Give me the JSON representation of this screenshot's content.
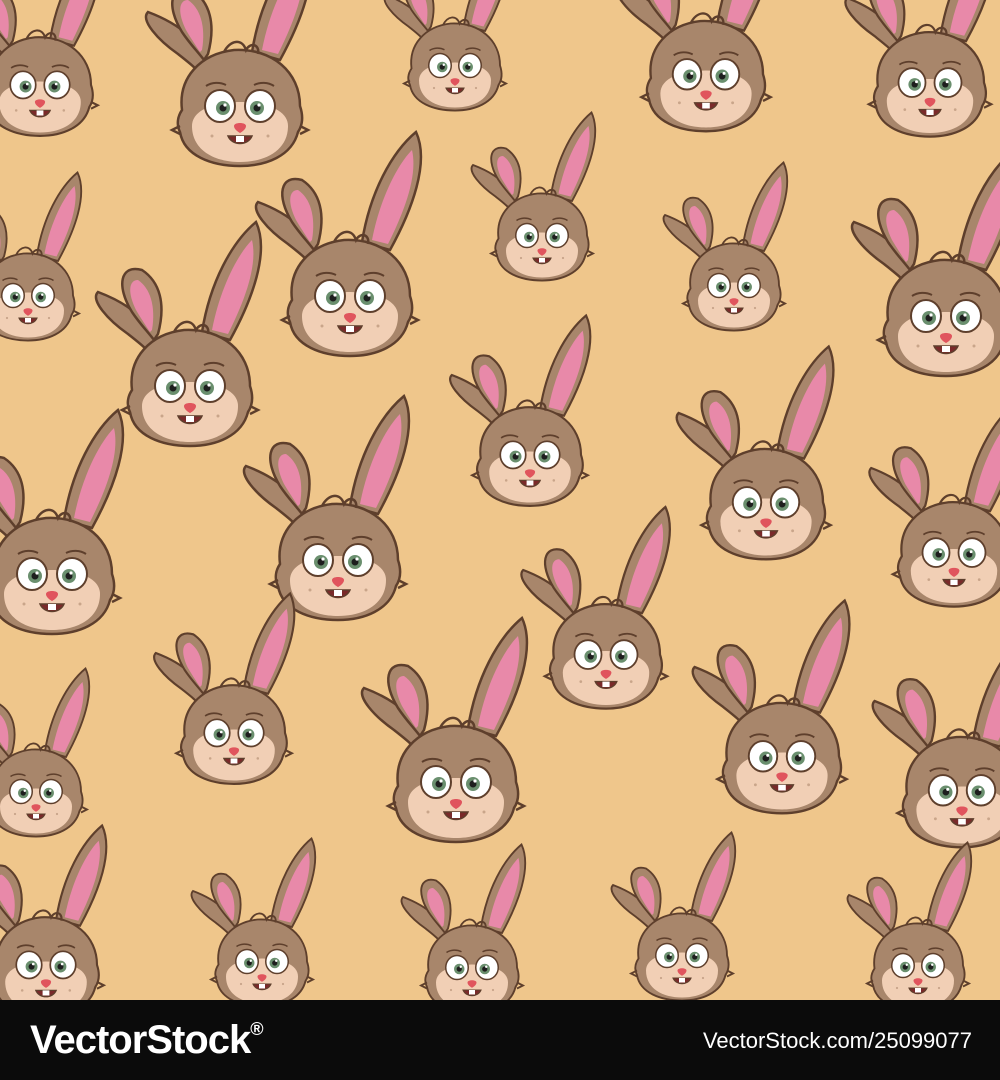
{
  "image": {
    "subject": "seamless pattern of cartoon bunny heads",
    "background_color": "#efc68b",
    "fur_color": "#a8866b",
    "fur_outline_color": "#5e3f2c",
    "muzzle_color": "#f1cfb5",
    "inner_ear_color": "#e889a9",
    "eye_iris_color": "#6a8f6e",
    "nose_color": "#e0545d"
  },
  "watermark": {
    "logo_text": "VectorStock",
    "logo_superscript": "®",
    "image_id": "VectorStock.com/25099077"
  }
}
